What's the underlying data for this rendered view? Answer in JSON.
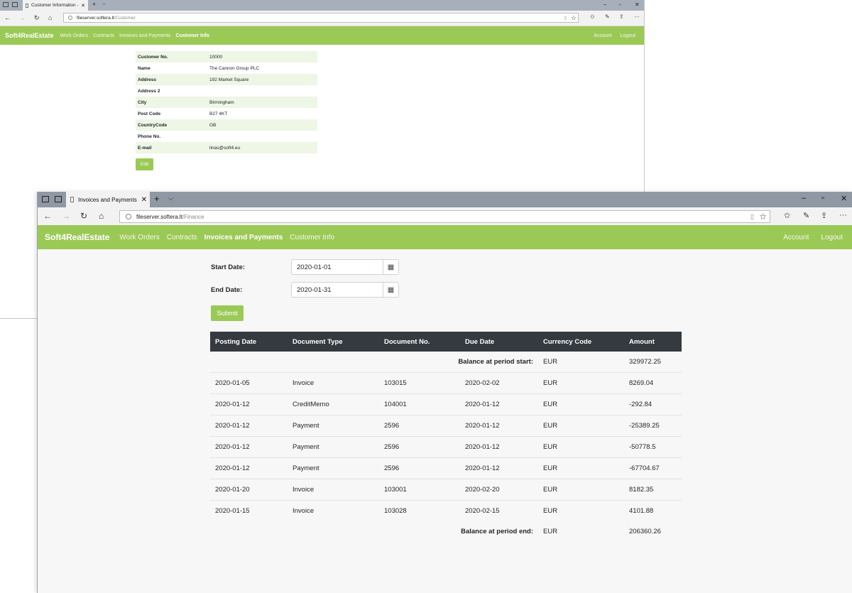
{
  "window1": {
    "tab_title": "Customer Information -",
    "url_host": "fileserver.softera.lt",
    "url_path": "/Customer",
    "brand": "Soft4RealEstate",
    "nav": [
      {
        "label": "Work Orders"
      },
      {
        "label": "Contracts"
      },
      {
        "label": "Invoices and Payments"
      },
      {
        "label": "Customer Info",
        "active": true
      }
    ],
    "nav_right": {
      "account": "Account",
      "logout": "Logout"
    },
    "fields": [
      {
        "label": "Customer No.",
        "value": "10000"
      },
      {
        "label": "Name",
        "value": "The Cannon Group PLC"
      },
      {
        "label": "Address",
        "value": "192 Market Square"
      },
      {
        "label": "Address 2",
        "value": ""
      },
      {
        "label": "City",
        "value": "Birmingham"
      },
      {
        "label": "Post Code",
        "value": "B27 4KT"
      },
      {
        "label": "CountryCode",
        "value": "GB"
      },
      {
        "label": "Phone No.",
        "value": ""
      },
      {
        "label": "E-mail",
        "value": "linas@soft4.eu"
      }
    ],
    "edit_label": "Edit"
  },
  "window2": {
    "tab_title": "Invoices and Payments",
    "url_host": "fileserver.softera.lt",
    "url_path": "/Finance",
    "brand": "Soft4RealEstate",
    "nav": [
      {
        "label": "Work Orders"
      },
      {
        "label": "Contracts"
      },
      {
        "label": "Invoices and Payments",
        "active": true
      },
      {
        "label": "Customer Info"
      }
    ],
    "nav_right": {
      "account": "Account",
      "logout": "Logout"
    },
    "form": {
      "start_label": "Start Date:",
      "start_value": "2020-01-01",
      "end_label": "End Date:",
      "end_value": "2020-01-31",
      "submit_label": "Submit"
    },
    "table": {
      "headers": [
        "Posting Date",
        "Document Type",
        "Document No.",
        "Due Date",
        "Currency Code",
        "Amount"
      ],
      "balance_start": {
        "label": "Balance at period start:",
        "currency": "EUR",
        "amount": "329972.25"
      },
      "rows": [
        [
          "2020-01-05",
          "Invoice",
          "103015",
          "2020-02-02",
          "EUR",
          "8269.04"
        ],
        [
          "2020-01-12",
          "CreditMemo",
          "104001",
          "2020-01-12",
          "EUR",
          "-292.84"
        ],
        [
          "2020-01-12",
          "Payment",
          "2596",
          "2020-01-12",
          "EUR",
          "-25389.25"
        ],
        [
          "2020-01-12",
          "Payment",
          "2596",
          "2020-01-12",
          "EUR",
          "-50778.5"
        ],
        [
          "2020-01-12",
          "Payment",
          "2596",
          "2020-01-12",
          "EUR",
          "-67704.67"
        ],
        [
          "2020-01-20",
          "Invoice",
          "103001",
          "2020-02-20",
          "EUR",
          "8182.35"
        ],
        [
          "2020-01-15",
          "Invoice",
          "103028",
          "2020-02-15",
          "EUR",
          "4101.88"
        ]
      ],
      "balance_end": {
        "label": "Balance at period end:",
        "currency": "EUR",
        "amount": "206360.26"
      }
    }
  },
  "colors": {
    "nav_green": "#9bc956",
    "table_header": "#353a40"
  }
}
